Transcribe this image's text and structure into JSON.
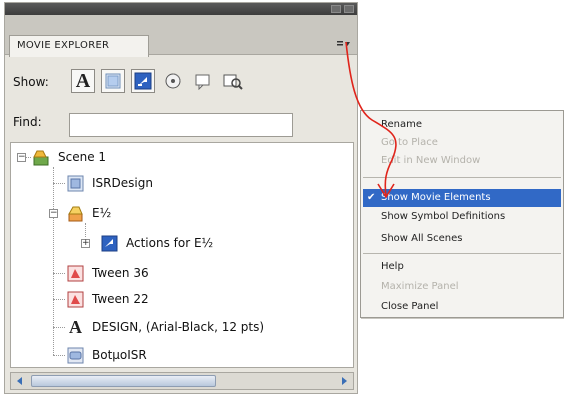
{
  "panel": {
    "tab_label": "MOVIE EXPLORER",
    "show_label": "Show:",
    "find_label": "Find:",
    "find_value": ""
  },
  "tree": [
    {
      "label": "Scene 1",
      "icon": "scene-icon"
    },
    {
      "label": "ISRDesign",
      "icon": "symbol-icon"
    },
    {
      "label": "E½",
      "icon": "movieclip-icon"
    },
    {
      "label": "Actions for E½",
      "icon": "actions-icon"
    },
    {
      "label": "Tween 36",
      "icon": "tween-symbol-icon"
    },
    {
      "label": "Tween 22",
      "icon": "tween-symbol-icon"
    },
    {
      "label": "DESIGN, (Arial-Black, 12 pts)",
      "icon": "text-icon"
    },
    {
      "label": "BotµoISR",
      "icon": "button-symbol-icon"
    }
  ],
  "menu": {
    "items": [
      {
        "label": "Rename",
        "state": "enabled"
      },
      {
        "label": "Go to Place",
        "state": "disabled"
      },
      {
        "label": "Edit in New Window",
        "state": "disabled"
      },
      {
        "label": "Show Movie Elements",
        "state": "checked"
      },
      {
        "label": "Show Symbol Definitions",
        "state": "enabled"
      },
      {
        "label": "Show All Scenes",
        "state": "enabled"
      },
      {
        "label": "Help",
        "state": "enabled"
      },
      {
        "label": "Maximize Panel",
        "state": "disabled"
      },
      {
        "label": "Close Panel",
        "state": "enabled"
      }
    ],
    "check_mark": "✔"
  },
  "colors": {
    "selection": "#3169c6",
    "annotation_arrow": "#e0241b",
    "panel_bg": "#e8e6df"
  },
  "icons": {
    "show_buttons": [
      "text-filter-icon",
      "buttons-movieclips-graphics-filter-icon",
      "actionscript-filter-icon",
      "video-sound-bitmap-filter-icon",
      "frames-layers-filter-icon",
      "customize-filter-icon"
    ]
  }
}
